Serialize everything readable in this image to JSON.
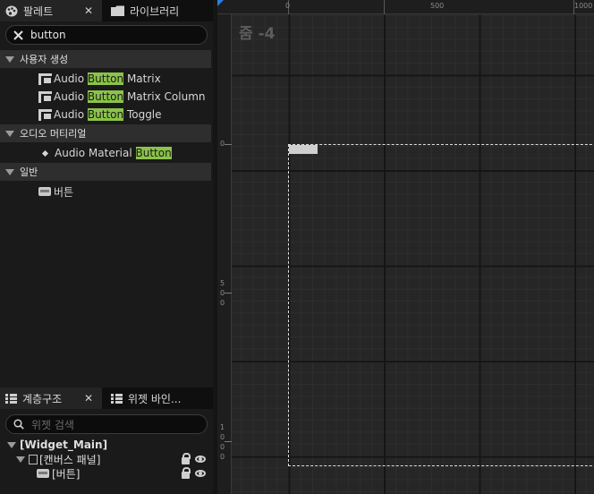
{
  "palette": {
    "tab_palette": "팔레트",
    "tab_library": "라이브러리",
    "close": "✕",
    "search_value": "button",
    "categories": [
      {
        "label": "사용자 생성",
        "items": [
          {
            "pre": "Audio ",
            "hl": "Button",
            "post": " Matrix",
            "icon": "widget-matrix-icon"
          },
          {
            "pre": "Audio ",
            "hl": "Button",
            "post": " Matrix Column",
            "icon": "widget-matrix-icon"
          },
          {
            "pre": "Audio ",
            "hl": "Button",
            "post": " Toggle",
            "icon": "widget-matrix-icon"
          }
        ]
      },
      {
        "label": "오디오 머티리얼",
        "items": [
          {
            "pre": "Audio Material ",
            "hl": "Button",
            "post": "",
            "icon": "diamond-bullet-icon"
          }
        ]
      },
      {
        "label": "일반",
        "items": [
          {
            "pre": "버튼",
            "hl": "",
            "post": "",
            "icon": "button-widget-icon"
          }
        ]
      }
    ]
  },
  "hierarchy": {
    "tab_hierarchy": "계층구조",
    "tab_bindings": "위젯 바인...",
    "search_placeholder": "위젯 검색",
    "root": "[Widget_Main]",
    "canvas": "[캔버스 패널]",
    "button": "[버튼]"
  },
  "designer": {
    "zoom": "줌 -4",
    "ruler_top": [
      "0",
      "500",
      "1000"
    ],
    "ruler_left": [
      [
        "0"
      ],
      [
        "5",
        "0",
        "0"
      ],
      [
        "1",
        "0",
        "0",
        "0"
      ]
    ]
  },
  "colors": {
    "highlight": "#8bc34a",
    "accent": "#2f7de1",
    "background": "#151515"
  }
}
